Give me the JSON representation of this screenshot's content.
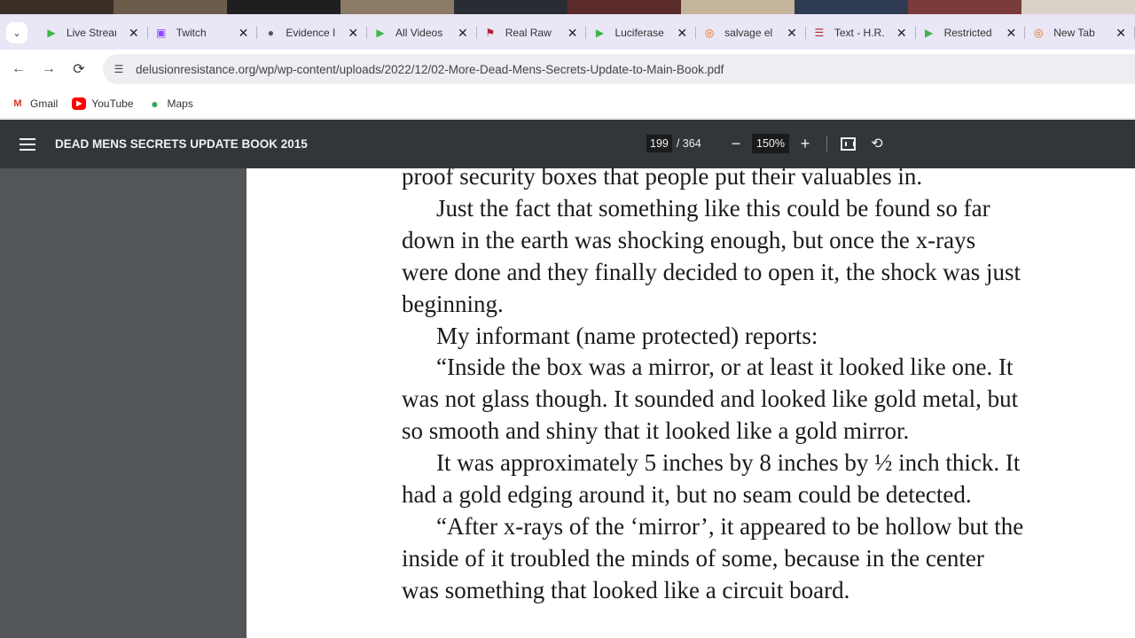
{
  "tabs": [
    {
      "title": "Live Stream",
      "icon": "play-icon",
      "color": "#3fb549"
    },
    {
      "title": "Twitch",
      "icon": "twitch-icon",
      "color": "#9146ff"
    },
    {
      "title": "Evidence I",
      "icon": "globe-icon",
      "color": "#555555"
    },
    {
      "title": "All Videos",
      "icon": "play-icon",
      "color": "#3fb549"
    },
    {
      "title": "Real Raw N",
      "icon": "flag-icon",
      "color": "#b22234"
    },
    {
      "title": "Luciferase",
      "icon": "play-icon",
      "color": "#3fb549"
    },
    {
      "title": "salvage el",
      "icon": "brave-icon",
      "color": "#e8630a"
    },
    {
      "title": "Text - H.R.",
      "icon": "us-flag-icon",
      "color": "#b22234"
    },
    {
      "title": "Restricted",
      "icon": "play-icon",
      "color": "#3fb549"
    },
    {
      "title": "New Tab",
      "icon": "brave-icon",
      "color": "#e8630a"
    }
  ],
  "address": {
    "url": "delusionresistance.org/wp/wp-content/uploads/2022/12/02-More-Dead-Mens-Secrets-Update-to-Main-Book.pdf"
  },
  "bookmarks": [
    {
      "label": "Gmail",
      "icon": "gmail-icon"
    },
    {
      "label": "YouTube",
      "icon": "youtube-icon"
    },
    {
      "label": "Maps",
      "icon": "maps-pin-icon"
    }
  ],
  "pdf": {
    "title": "DEAD MENS SECRETS UPDATE BOOK 2015",
    "page_current": "199",
    "page_total": "/ 364",
    "zoom": "150%",
    "zoom_out": "−",
    "zoom_in": "+",
    "fit_icon": "fit-page-icon",
    "rotate_icon": "rotate-icon"
  },
  "document": {
    "lines": [
      "proof security boxes that people put their valuables in.",
      "Just the fact that something like this could be found so far",
      "down in the earth was shocking enough, but once the x-rays",
      "were done and they finally decided to open it, the shock was just",
      "beginning.",
      "My informant (name protected) reports:",
      "“Inside the box was a mirror, or at least it looked like one. It",
      "was not glass though. It sounded and looked like gold metal, but",
      "so smooth and shiny that it looked like a gold mirror.",
      "It was approximately 5 inches by 8 inches by ½ inch thick. It",
      "had a gold edging around it, but no seam could be detected.",
      "“After x-rays of the ‘mirror’, it appeared to be hollow but the",
      "inside of it troubled the minds of some, because in the center",
      "was something that looked like a circuit board."
    ]
  },
  "colors": {
    "tabstrip_bg": "#e9e6f5",
    "pdf_toolbar_bg": "#323639",
    "pdf_sidebar_bg": "#525659"
  }
}
